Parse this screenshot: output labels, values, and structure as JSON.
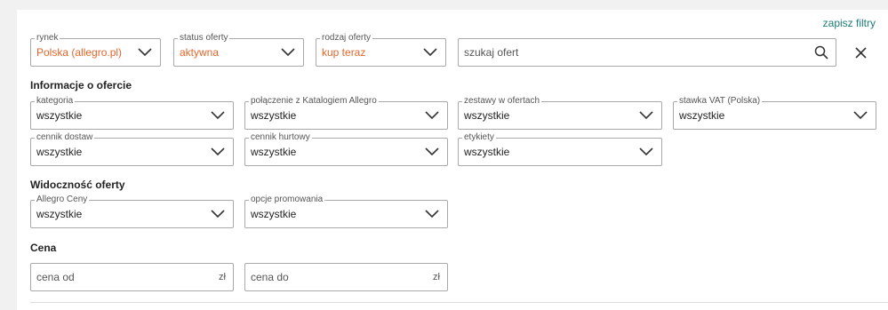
{
  "header": {
    "save_filters": "zapisz filtry"
  },
  "top": {
    "market": {
      "legend": "rynek",
      "value": "Polska (allegro.pl)"
    },
    "offer_status": {
      "legend": "status oferty",
      "value": "aktywna"
    },
    "offer_type": {
      "legend": "rodzaj oferty",
      "value": "kup teraz"
    },
    "search": {
      "placeholder": "szukaj ofert"
    }
  },
  "sections": {
    "offer_info": "Informacje o ofercie",
    "visibility": "Widoczność oferty",
    "price": "Cena"
  },
  "offer_info": {
    "category": {
      "legend": "kategoria",
      "value": "wszystkie"
    },
    "catalog": {
      "legend": "połączenie z Katalogiem Allegro",
      "value": "wszystkie"
    },
    "bundles": {
      "legend": "zestawy w ofertach",
      "value": "wszystkie"
    },
    "vat": {
      "legend": "stawka VAT (Polska)",
      "value": "wszystkie"
    },
    "shipping": {
      "legend": "cennik dostaw",
      "value": "wszystkie"
    },
    "wholesale": {
      "legend": "cennik hurtowy",
      "value": "wszystkie"
    },
    "labels": {
      "legend": "etykiety",
      "value": "wszystkie"
    }
  },
  "visibility": {
    "allegro_prices": {
      "legend": "Allegro Ceny",
      "value": "wszystkie"
    },
    "promotion": {
      "legend": "opcje promowania",
      "value": "wszystkie"
    }
  },
  "price": {
    "from": {
      "placeholder": "cena od",
      "unit": "zł"
    },
    "to": {
      "placeholder": "cena do",
      "unit": "zł"
    }
  },
  "colors": {
    "accent_orange": "#e2662b",
    "link_teal": "#1b7c75",
    "border": "#a9a9a9"
  },
  "icons": [
    "chevron-down-icon",
    "search-icon",
    "close-icon"
  ]
}
